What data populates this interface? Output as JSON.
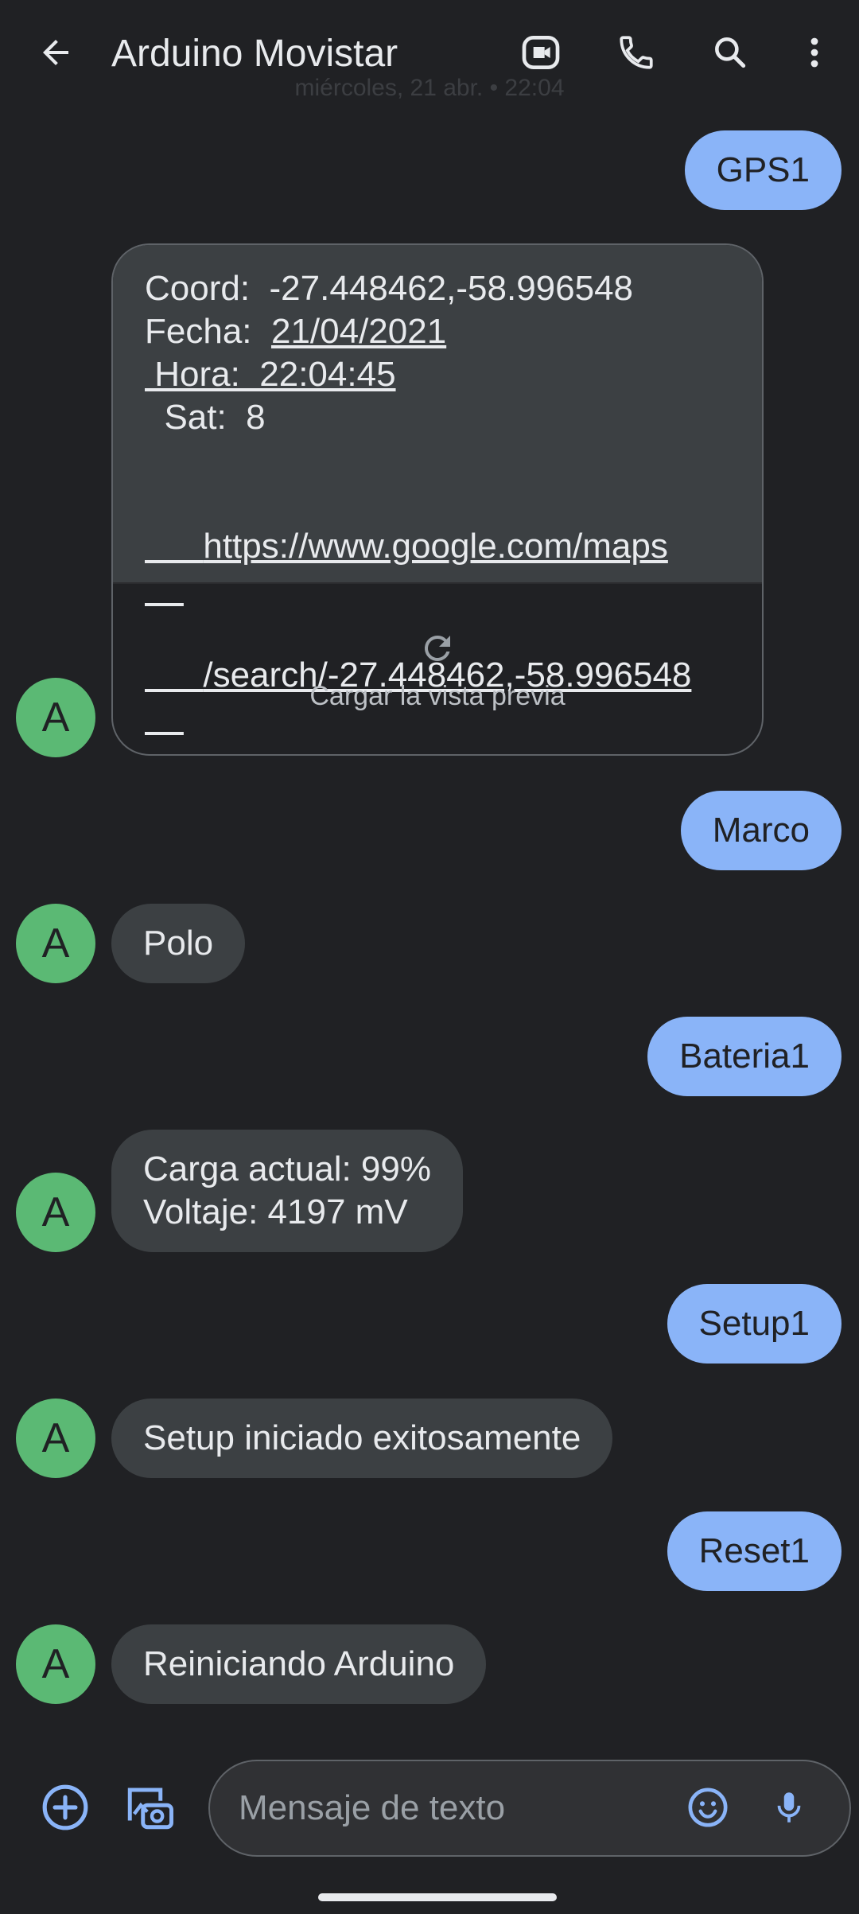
{
  "header": {
    "title": "Arduino Movistar",
    "date_stamp": "miércoles, 21 abr. • 22:04"
  },
  "contact": {
    "avatar_letter": "A"
  },
  "messages": [
    {
      "id": "m1",
      "direction": "outgoing",
      "text": "GPS1"
    },
    {
      "id": "m2",
      "direction": "incoming",
      "lines": [
        "Coord:  -27.448462,-58.996548",
        "Fecha:  ",
        "21/04/2021",
        " Hora:  22:04:45",
        "  Sat:  8"
      ],
      "link_lines": [
        "https://www.google.com/maps",
        "/search/-27.448462,-58.996548"
      ],
      "preview_label": "Cargar la vista previa"
    },
    {
      "id": "m3",
      "direction": "outgoing",
      "text": "Marco"
    },
    {
      "id": "m4",
      "direction": "incoming",
      "text": "Polo"
    },
    {
      "id": "m5",
      "direction": "outgoing",
      "text": "Bateria1"
    },
    {
      "id": "m6",
      "direction": "incoming",
      "lines": [
        "Carga actual: 99%",
        "Voltaje: 4197 mV"
      ]
    },
    {
      "id": "m7",
      "direction": "outgoing",
      "text": "Setup1"
    },
    {
      "id": "m8",
      "direction": "incoming",
      "text": "Setup iniciado exitosamente"
    },
    {
      "id": "m9",
      "direction": "outgoing",
      "text": "Reset1"
    },
    {
      "id": "m10",
      "direction": "incoming",
      "text": "Reiniciando Arduino"
    }
  ],
  "composer": {
    "placeholder": "Mensaje de texto"
  },
  "colors": {
    "background": "#202124",
    "outgoing_bubble": "#8ab4f8",
    "incoming_bubble": "#3c4043",
    "avatar": "#5bb974",
    "accent_icon": "#8ab4f8"
  },
  "icons": {
    "back": "arrow-left-icon",
    "video": "video-call-icon",
    "call": "phone-icon",
    "search": "search-icon",
    "menu": "more-vert-icon",
    "reload": "refresh-icon",
    "add": "add-circle-icon",
    "gallery": "gallery-camera-icon",
    "emoji": "emoji-icon",
    "mic": "mic-icon"
  }
}
